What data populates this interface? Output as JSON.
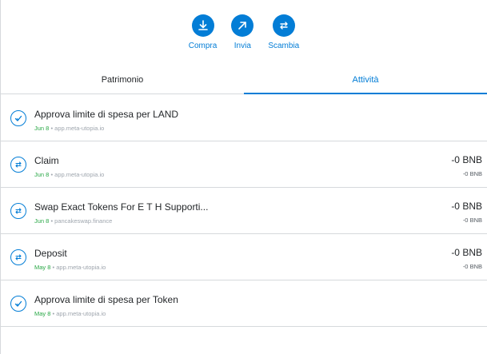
{
  "actions": [
    {
      "label": "Compra",
      "icon": "download-icon"
    },
    {
      "label": "Invia",
      "icon": "arrow-up-right-icon"
    },
    {
      "label": "Scambia",
      "icon": "swap-icon"
    }
  ],
  "tabs": [
    {
      "label": "Patrimonio",
      "active": false
    },
    {
      "label": "Attività",
      "active": true
    }
  ],
  "activities": [
    {
      "title": "Approva limite di spesa per LAND",
      "date": "Jun 8",
      "origin": "app.meta-utopia.io",
      "amount": "",
      "amount_sub": "",
      "icon": "check-icon"
    },
    {
      "title": "Claim",
      "date": "Jun 8",
      "origin": "app.meta-utopia.io",
      "amount": "-0 BNB",
      "amount_sub": "-0 BNB",
      "icon": "swap-icon"
    },
    {
      "title": "Swap Exact Tokens For E T H Supporti...",
      "date": "Jun 8",
      "origin": "pancakeswap.finance",
      "amount": "-0 BNB",
      "amount_sub": "-0 BNB",
      "icon": "swap-icon"
    },
    {
      "title": "Deposit",
      "date": "May 8",
      "origin": "app.meta-utopia.io",
      "amount": "-0 BNB",
      "amount_sub": "-0 BNB",
      "icon": "swap-icon"
    },
    {
      "title": "Approva limite di spesa per Token",
      "date": "May 8",
      "origin": "app.meta-utopia.io",
      "amount": "",
      "amount_sub": "",
      "icon": "check-icon"
    }
  ],
  "meta_separator": " • ",
  "colors": {
    "accent": "#037dd6",
    "date_green": "#28a745",
    "muted": "#9fa6ae",
    "border": "#d6d9dc"
  }
}
